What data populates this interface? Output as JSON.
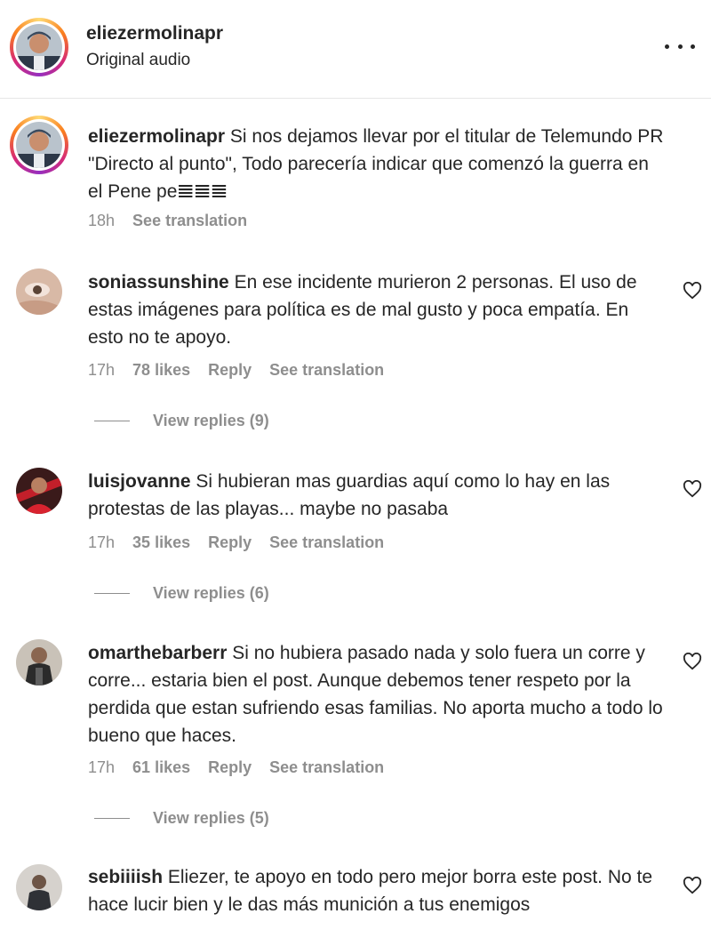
{
  "header": {
    "username": "eliezermolinapr",
    "subtitle": "Original audio",
    "more_icon": "more-horizontal-icon"
  },
  "caption": {
    "username": "eliezermolinapr",
    "text": "Si nos dejamos llevar por el titular de Telemundo PR \"Directo al punto\", Todo parecería indicar que comenzó la guerra en el Pene pe𝌆𝌆𝌆",
    "time": "18h",
    "translate": "See translation"
  },
  "comments": [
    {
      "username": "soniassunshine",
      "text": "En ese incidente murieron 2 personas. El uso de estas imágenes para política es de mal gusto y poca empatía. En esto no te apoyo.",
      "time": "17h",
      "likes": "78 likes",
      "reply": "Reply",
      "translate": "See translation",
      "view_replies": "View replies (9)"
    },
    {
      "username": "luisjovanne",
      "text": "Si hubieran mas guardias aquí como lo hay en las protestas de las playas... maybe no pasaba",
      "time": "17h",
      "likes": "35 likes",
      "reply": "Reply",
      "translate": "See translation",
      "view_replies": "View replies (6)"
    },
    {
      "username": "omarthebarberr",
      "text": "Si no hubiera pasado nada y solo fuera un corre y corre... estaria bien el post. Aunque debemos tener respeto por la perdida que estan sufriendo esas familias. No aporta mucho a todo lo bueno que haces.",
      "time": "17h",
      "likes": "61 likes",
      "reply": "Reply",
      "translate": "See translation",
      "view_replies": "View replies (5)"
    },
    {
      "username": "sebiiiish",
      "text": "Eliezer, te apoyo en todo pero mejor borra este post. No te hace lucir bien y le das más munición a tus enemigos"
    }
  ],
  "icons": {
    "like": "heart-outline-icon"
  },
  "colors": {
    "text": "#262626",
    "secondary": "#8e8e8e",
    "divider": "#e6e6e6"
  }
}
